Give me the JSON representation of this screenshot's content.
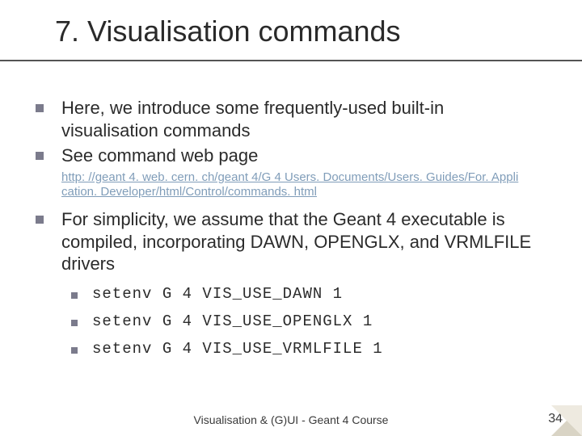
{
  "title": "7. Visualisation commands",
  "bullets": {
    "b1": "Here, we introduce some frequently-used built-in visualisation commands",
    "b2": "See command web page",
    "b3": "For simplicity, we assume that the Geant 4 executable is compiled, incorporating DAWN, OPENGLX, and VRMLFILE drivers"
  },
  "link": {
    "line1": "http: //geant 4. web. cern. ch/geant 4/G 4 Users. Documents/Users. Guides/For. Appli",
    "line2": "cation. Developer/html/Control/commands. html"
  },
  "subs": {
    "s1": "setenv G 4 VIS_USE_DAWN 1",
    "s2": "setenv G 4 VIS_USE_OPENGLX 1",
    "s3": "setenv G 4 VIS_USE_VRMLFILE 1"
  },
  "footer": "Visualisation & (G)UI - Geant 4 Course",
  "page": "34"
}
